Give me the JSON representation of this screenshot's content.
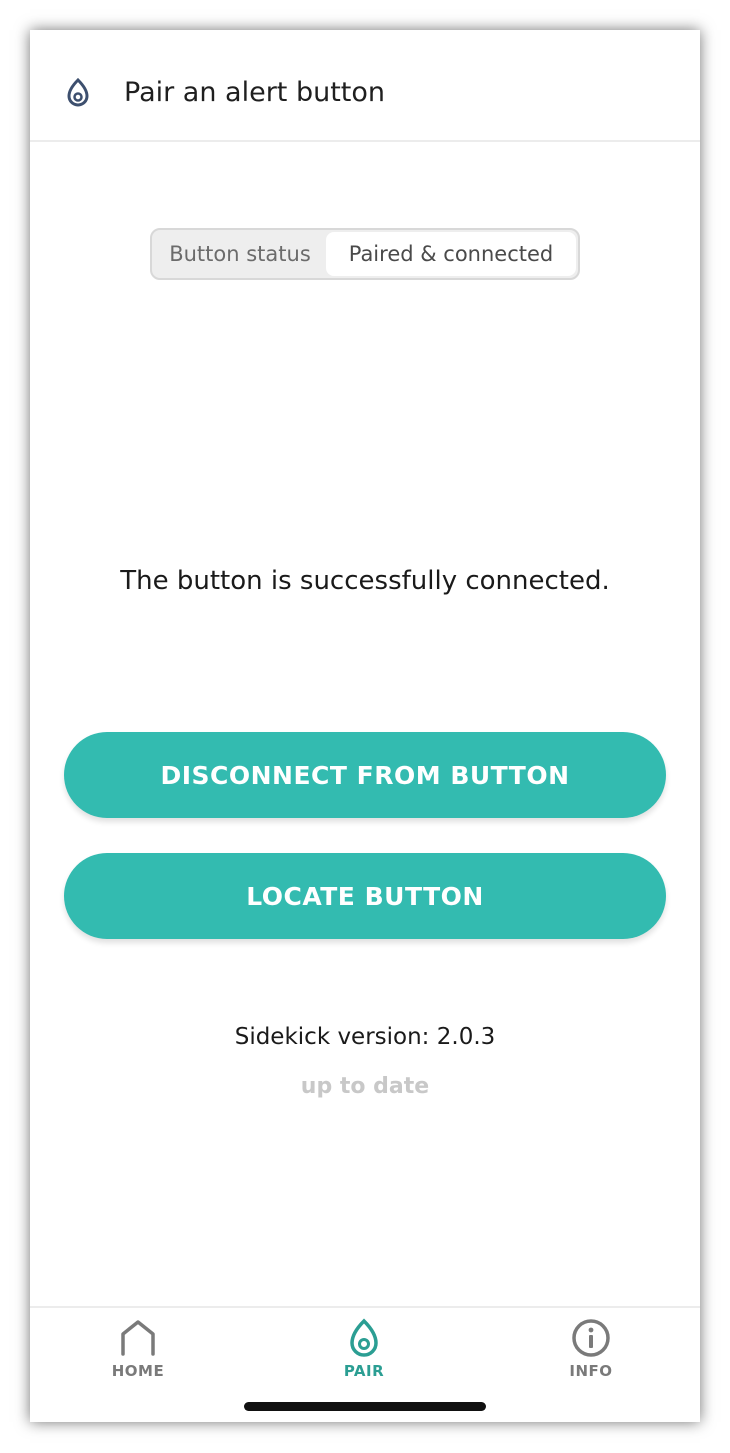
{
  "header": {
    "icon": "alert-button-icon",
    "title": "Pair an alert button"
  },
  "status_segment": {
    "label": "Button status",
    "value": "Paired & connected"
  },
  "main": {
    "message": "The button is successfully connected.",
    "disconnect_label": "DISCONNECT FROM BUTTON",
    "locate_label": "LOCATE BUTTON",
    "version": "Sidekick version: 2.0.3",
    "version_status": "up to date"
  },
  "tabbar": {
    "items": [
      {
        "label": "HOME",
        "icon": "home-icon"
      },
      {
        "label": "PAIR",
        "icon": "alert-button-icon",
        "active": true
      },
      {
        "label": "INFO",
        "icon": "info-icon"
      }
    ]
  },
  "colors": {
    "accent": "#33bbb0",
    "active_tab": "#2b9e93",
    "header_icon": "#3d4f6e",
    "muted": "#c8c8c8"
  }
}
